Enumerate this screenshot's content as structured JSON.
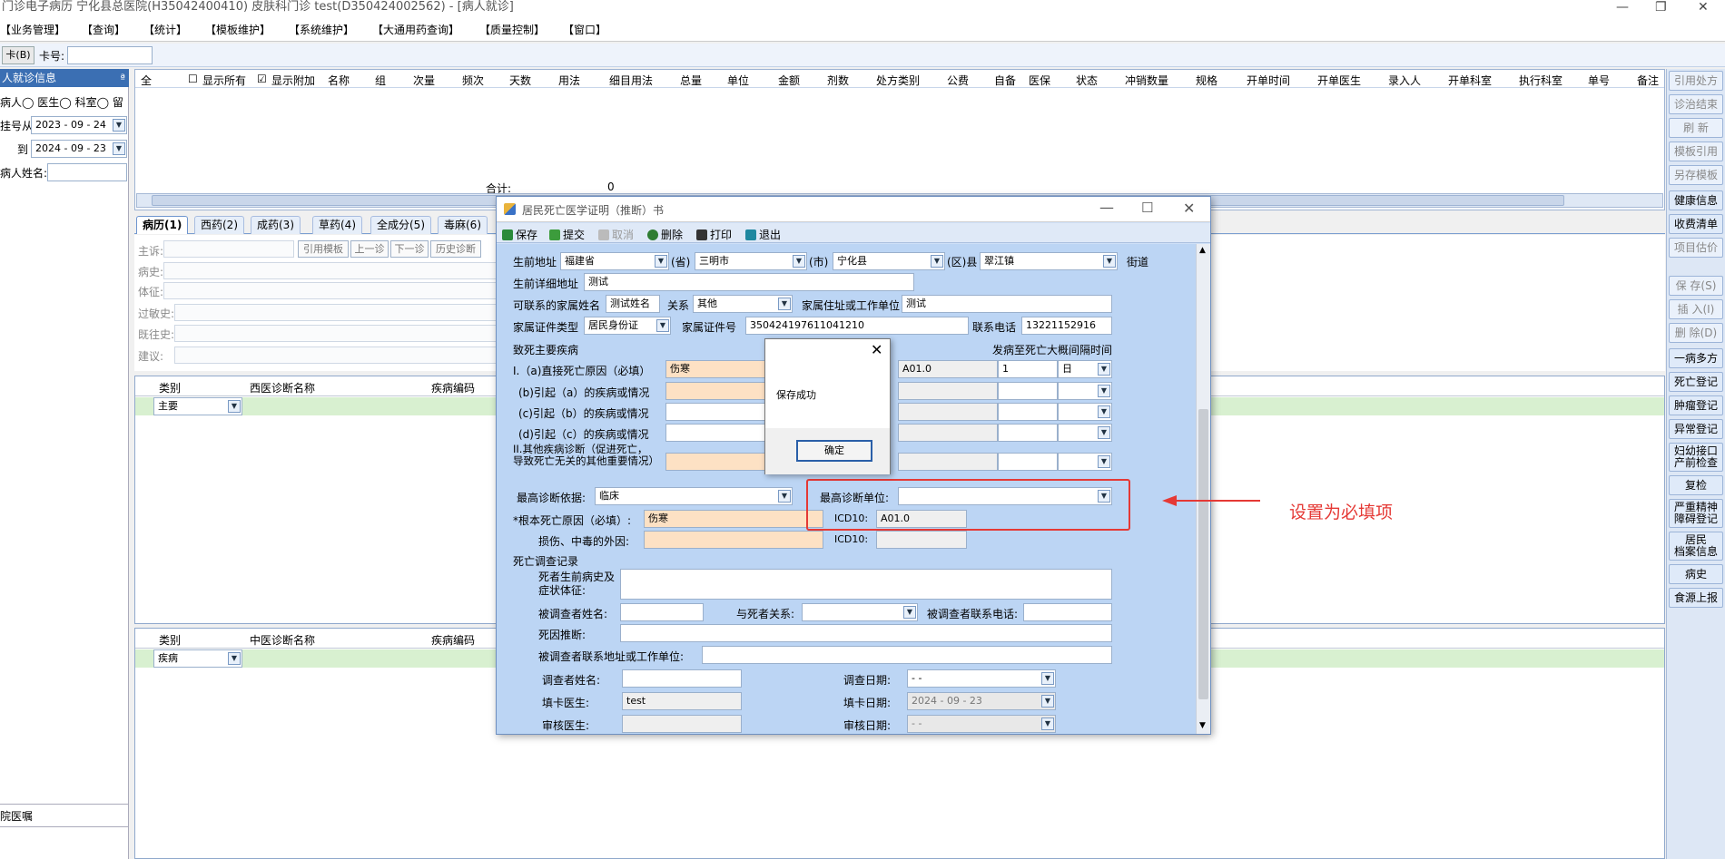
{
  "window": {
    "title": "门诊电子病历  宁化县总医院(H35042400410)  皮肤科门诊  test(D350424002562) - [病人就诊]"
  },
  "menu": [
    "【业务管理】",
    "【查询】",
    "【统计】",
    "【模板维护】",
    "【系统维护】",
    "【大通用药查询】",
    "【质量控制】",
    "【窗口】"
  ],
  "toolbar": {
    "card_btn": "卡(B)",
    "card_label": "卡号:",
    "card_value": ""
  },
  "left": {
    "header": "人就诊信息",
    "pin": "ª",
    "radio_labels": [
      "病人",
      "医生",
      "科室",
      "留"
    ],
    "from_label": "挂号从",
    "from_value": "2023 - 09 - 24",
    "to_label": "到",
    "to_value": "2024 - 09 - 23",
    "name_label": "病人姓名:",
    "bottom_header": "院医嘱"
  },
  "grid": {
    "all_label": "全",
    "show_all": "显示所有",
    "show_extra": "显示附加",
    "columns": [
      "名称",
      "组",
      "次量",
      "频次",
      "天数",
      "用法",
      "细目用法",
      "总量",
      "单位",
      "金额",
      "剂数",
      "处方类别",
      "公费",
      "自备",
      "医保",
      "状态",
      "冲销数量",
      "规格",
      "开单时间",
      "开单医生",
      "录入人",
      "开单科室",
      "执行科室",
      "单号",
      "备注"
    ],
    "total_label": "合计:",
    "total_value": "0"
  },
  "tabs": [
    "病历(1)",
    "西药(2)",
    "成药(3)",
    "草药(4)",
    "全成分(5)",
    "毒麻(6)"
  ],
  "emr": {
    "labels": [
      "主诉:",
      "病史:",
      "体征:",
      "过敏史:",
      "既往史:",
      "建议:"
    ],
    "buttons": [
      "引用模板",
      "上一诊",
      "下一诊",
      "历史诊断"
    ]
  },
  "diag_west": {
    "headers": [
      "类别",
      "西医诊断名称",
      "疾病编码"
    ],
    "row_type": "主要"
  },
  "diag_chinese": {
    "headers": [
      "类别",
      "中医诊断名称",
      "疾病编码"
    ],
    "row_type": "疾病"
  },
  "rightbar": [
    "引用处方",
    "诊治结束",
    "刷 新",
    "模板引用",
    "另存模板",
    "健康信息",
    "收费清单",
    "项目估价",
    "保 存(S)",
    "插 入(I)",
    "删 除(D)",
    "一病多方",
    "死亡登记",
    "肿瘤登记",
    "异常登记",
    "妇幼接口\n产前检查",
    "复检",
    "严重精神\n障碍登记",
    "居民\n档案信息",
    "病史",
    "食源上报"
  ],
  "dialog": {
    "title": "居民死亡医学证明（推断）书",
    "toolbar": [
      "保存",
      "提交",
      "取消",
      "删除",
      "打印",
      "退出"
    ],
    "address_label": "生前地址",
    "province": "福建省",
    "province_suffix": "(省)",
    "city": "三明市",
    "city_suffix": "(市)",
    "county": "宁化县",
    "county_suffix": "(区)县",
    "town": "翠江镇",
    "street_suffix": "街道",
    "detail_addr_label": "生前详细地址",
    "detail_addr": "测试",
    "family_name_label": "可联系的家属姓名",
    "family_name": "测试姓名",
    "relation_label": "关系",
    "relation": "其他",
    "family_addr_label": "家属住址或工作单位",
    "family_addr": "测试",
    "id_type_label": "家属证件类型",
    "id_type": "居民身份证",
    "id_no_label": "家属证件号",
    "id_no": "350424197611041210",
    "phone_label": "联系电话",
    "phone": "13221152916",
    "cause_title": "致死主要疾病",
    "interval_title": "发病至死亡大概间隔时间",
    "cause_a_label": "I.（a)直接死亡原因（必填）",
    "cause_a": "伤寒",
    "icd_a": "A01.0",
    "interval_a": "1",
    "unit_a": "日",
    "cause_b_label": "(b)引起（a）的疾病或情况",
    "cause_c_label": "(c)引起（b）的疾病或情况",
    "cause_d_label": "(d)引起（c）的疾病或情况",
    "other_label": "II.其他疾病诊断（促进死亡，导致死亡无关的其他重要情况）",
    "basis_label": "最高诊断依据:",
    "basis": "临床",
    "unit_label": "最高诊断单位:",
    "unit_value": "",
    "root_label": "*根本死亡原因（必填）:",
    "root_value": "伤寒",
    "icd_label": "ICD10:",
    "root_icd": "A01.0",
    "injury_label": "损伤、中毒的外因:",
    "icd_label2": "ICD10:",
    "survey_title": "死亡调查记录",
    "history_label": "死者生前病史及症状体征:",
    "respondent_label": "被调查者姓名:",
    "resp_relation_label": "与死者关系:",
    "resp_phone_label": "被调查者联系电话:",
    "inference_label": "死因推断:",
    "resp_addr_label": "被调查者联系地址或工作单位:",
    "investigator_label": "调查者姓名:",
    "survey_date_label": "调查日期:",
    "survey_date": "-  -",
    "doctor_label": "填卡医生:",
    "doctor": "test",
    "fill_date_label": "填卡日期:",
    "fill_date": "2024 - 09 - 23",
    "reviewer_label": "审核医生:",
    "review_date_label": "审核日期:",
    "review_date": "-  -"
  },
  "msgbox": {
    "text": "保存成功",
    "ok": "确定"
  },
  "annotation": {
    "note": "设置为必填项",
    "color": "#e53935"
  }
}
